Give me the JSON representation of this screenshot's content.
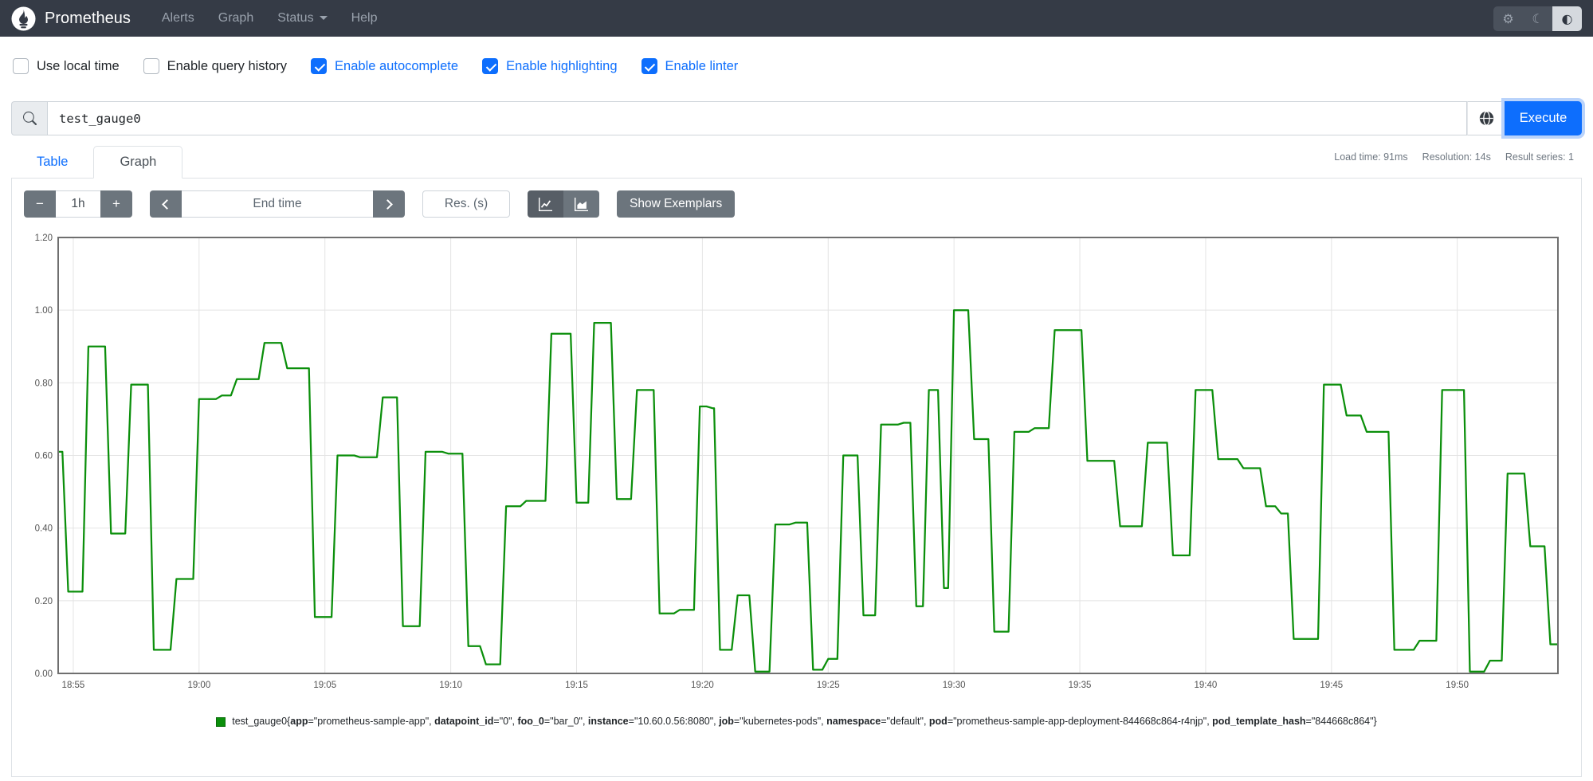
{
  "navbar": {
    "brand": "Prometheus",
    "items": [
      {
        "label": "Alerts",
        "has_caret": false
      },
      {
        "label": "Graph",
        "has_caret": false
      },
      {
        "label": "Status",
        "has_caret": true
      },
      {
        "label": "Help",
        "has_caret": false
      }
    ],
    "theme_buttons": [
      "settings-gear-icon",
      "dark-mode-moon-icon",
      "auto-theme-contrast-icon"
    ],
    "active_theme_button": "auto-theme-contrast-icon"
  },
  "options": {
    "items": [
      {
        "label": "Use local time",
        "checked": false
      },
      {
        "label": "Enable query history",
        "checked": false
      },
      {
        "label": "Enable autocomplete",
        "checked": true
      },
      {
        "label": "Enable highlighting",
        "checked": true
      },
      {
        "label": "Enable linter",
        "checked": true
      }
    ]
  },
  "query": {
    "value": "test_gauge0",
    "execute_label": "Execute",
    "icons": [
      "search-icon",
      "metrics-explorer-globe-icon"
    ]
  },
  "tabs": {
    "items": [
      {
        "label": "Table",
        "active": false
      },
      {
        "label": "Graph",
        "active": true
      }
    ]
  },
  "stats": {
    "load_time": "Load time: 91ms",
    "resolution": "Resolution: 14s",
    "result_series": "Result series: 1"
  },
  "controls": {
    "minus": "−",
    "range_value": "1h",
    "plus": "+",
    "end_time_placeholder": "End time",
    "res_placeholder": "Res. (s)",
    "show_exemplars": "Show Exemplars",
    "chart_type_icons": [
      "line-chart-icon",
      "stacked-chart-icon"
    ],
    "selected_chart_type": "line-chart-icon"
  },
  "chart_data": {
    "type": "line",
    "step": true,
    "title": "",
    "xlabel": "",
    "ylabel": "",
    "ylim": [
      0,
      1.2
    ],
    "yticks": [
      "0.00",
      "0.20",
      "0.40",
      "0.60",
      "0.80",
      "1.00",
      "1.20"
    ],
    "x_range_minutes_after_1800": [
      54.4,
      114.0
    ],
    "xticks": [
      {
        "t": 55,
        "label": "18:55"
      },
      {
        "t": 60,
        "label": "19:00"
      },
      {
        "t": 65,
        "label": "19:05"
      },
      {
        "t": 70,
        "label": "19:10"
      },
      {
        "t": 75,
        "label": "19:15"
      },
      {
        "t": 80,
        "label": "19:20"
      },
      {
        "t": 85,
        "label": "19:25"
      },
      {
        "t": 90,
        "label": "19:30"
      },
      {
        "t": 95,
        "label": "19:35"
      },
      {
        "t": 100,
        "label": "19:40"
      },
      {
        "t": 105,
        "label": "19:45"
      },
      {
        "t": 110,
        "label": "19:50"
      }
    ],
    "grid": true,
    "legend_position": "bottom-center",
    "resolution_seconds": 14,
    "series": [
      {
        "name": "test_gauge0",
        "color": "#0b8f0b",
        "points": [
          [
            54.4,
            0.61
          ],
          [
            54.8,
            0.225
          ],
          [
            55.6,
            0.9
          ],
          [
            56.5,
            0.385
          ],
          [
            57.3,
            0.795
          ],
          [
            58.2,
            0.065
          ],
          [
            59.1,
            0.26
          ],
          [
            60.0,
            0.755
          ],
          [
            60.9,
            0.765
          ],
          [
            61.5,
            0.81
          ],
          [
            62.6,
            0.91
          ],
          [
            63.5,
            0.84
          ],
          [
            64.6,
            0.155
          ],
          [
            65.5,
            0.6
          ],
          [
            66.4,
            0.595
          ],
          [
            67.3,
            0.76
          ],
          [
            68.1,
            0.13
          ],
          [
            69.0,
            0.61
          ],
          [
            69.9,
            0.605
          ],
          [
            70.7,
            0.075
          ],
          [
            71.4,
            0.025
          ],
          [
            72.2,
            0.46
          ],
          [
            73.0,
            0.475
          ],
          [
            74.0,
            0.935
          ],
          [
            75.0,
            0.47
          ],
          [
            75.7,
            0.965
          ],
          [
            76.6,
            0.48
          ],
          [
            77.4,
            0.78
          ],
          [
            78.3,
            0.165
          ],
          [
            79.1,
            0.175
          ],
          [
            79.9,
            0.735
          ],
          [
            80.4,
            0.73
          ],
          [
            80.7,
            0.065
          ],
          [
            81.4,
            0.215
          ],
          [
            82.1,
            0.005
          ],
          [
            82.9,
            0.41
          ],
          [
            83.7,
            0.415
          ],
          [
            84.4,
            0.01
          ],
          [
            85.0,
            0.04
          ],
          [
            85.6,
            0.6
          ],
          [
            86.4,
            0.16
          ],
          [
            87.1,
            0.685
          ],
          [
            88.0,
            0.69
          ],
          [
            88.5,
            0.185
          ],
          [
            89.0,
            0.78
          ],
          [
            89.6,
            0.235
          ],
          [
            90.0,
            1.0
          ],
          [
            90.8,
            0.645
          ],
          [
            91.6,
            0.115
          ],
          [
            92.4,
            0.665
          ],
          [
            93.2,
            0.675
          ],
          [
            94.0,
            0.945
          ],
          [
            95.3,
            0.585
          ],
          [
            96.6,
            0.405
          ],
          [
            97.7,
            0.635
          ],
          [
            98.7,
            0.325
          ],
          [
            99.6,
            0.78
          ],
          [
            100.5,
            0.59
          ],
          [
            101.5,
            0.565
          ],
          [
            102.4,
            0.46
          ],
          [
            103.0,
            0.44
          ],
          [
            103.5,
            0.095
          ],
          [
            104.7,
            0.795
          ],
          [
            105.6,
            0.71
          ],
          [
            106.4,
            0.665
          ],
          [
            107.5,
            0.065
          ],
          [
            108.5,
            0.09
          ],
          [
            109.4,
            0.78
          ],
          [
            110.5,
            0.005
          ],
          [
            111.3,
            0.035
          ],
          [
            112.0,
            0.55
          ],
          [
            112.9,
            0.35
          ],
          [
            113.7,
            0.08
          ]
        ]
      }
    ]
  },
  "legend": {
    "metric": "test_gauge0",
    "labels": [
      {
        "name": "app",
        "value": "prometheus-sample-app"
      },
      {
        "name": "datapoint_id",
        "value": "0"
      },
      {
        "name": "foo_0",
        "value": "bar_0"
      },
      {
        "name": "instance",
        "value": "10.60.0.56:8080"
      },
      {
        "name": "job",
        "value": "kubernetes-pods"
      },
      {
        "name": "namespace",
        "value": "default"
      },
      {
        "name": "pod",
        "value": "prometheus-sample-app-deployment-844668c864-r4njp"
      },
      {
        "name": "pod_template_hash",
        "value": "844668c864"
      }
    ]
  },
  "colors": {
    "accent_blue": "#0d6efd",
    "navbar_bg": "#353b46",
    "series_green": "#0b8f0b",
    "grid": "#e4e4e4",
    "plot_border": "#6f6f6f",
    "control_gray": "#6c757d"
  }
}
